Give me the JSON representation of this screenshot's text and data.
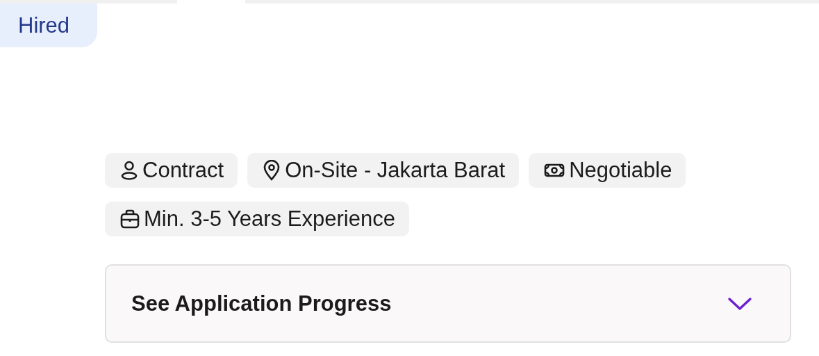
{
  "status_badge": {
    "label": "Hired"
  },
  "tags": [
    {
      "kind": "person",
      "label": "Contract"
    },
    {
      "kind": "location",
      "label": "On-Site - Jakarta Barat"
    },
    {
      "kind": "money",
      "label": "Negotiable"
    },
    {
      "kind": "briefcase",
      "label": "Min. 3-5 Years Experience"
    }
  ],
  "accordion": {
    "title": "See Application Progress",
    "expanded": false
  }
}
